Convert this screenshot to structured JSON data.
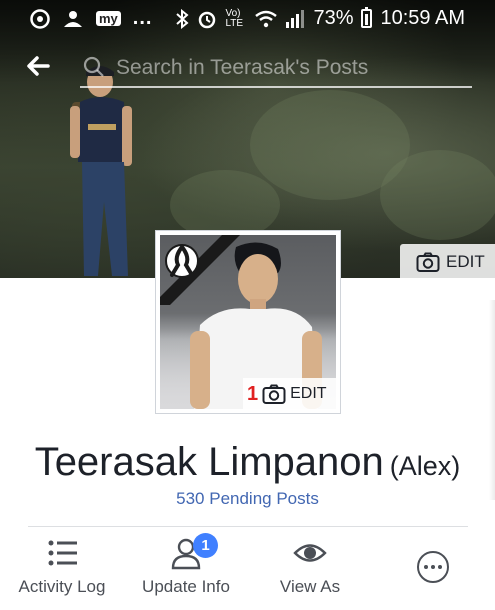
{
  "status_bar": {
    "battery": "73%",
    "time": "10:59 AM",
    "network": "Vo) LTE",
    "app_badge": "my",
    "more": "..."
  },
  "header": {
    "search_placeholder": "Search in Teerasak's Posts"
  },
  "cover": {
    "edit_label": "EDIT"
  },
  "profile_picture": {
    "edit_label": "EDIT",
    "marker": "1"
  },
  "profile": {
    "name": "Teerasak Limpanon",
    "alternate_name": "(Alex)",
    "pending_posts": "530 Pending Posts"
  },
  "actions": [
    {
      "label": "Activity Log",
      "icon": "activity-log-icon"
    },
    {
      "label": "Update Info",
      "icon": "update-info-icon",
      "badge": "1"
    },
    {
      "label": "View As",
      "icon": "eye-icon"
    },
    {
      "label": "",
      "icon": "more-icon"
    }
  ],
  "colors": {
    "link": "#4267b2",
    "badge": "#4080ff",
    "text": "#1d2129",
    "icon": "#4b4f56"
  }
}
